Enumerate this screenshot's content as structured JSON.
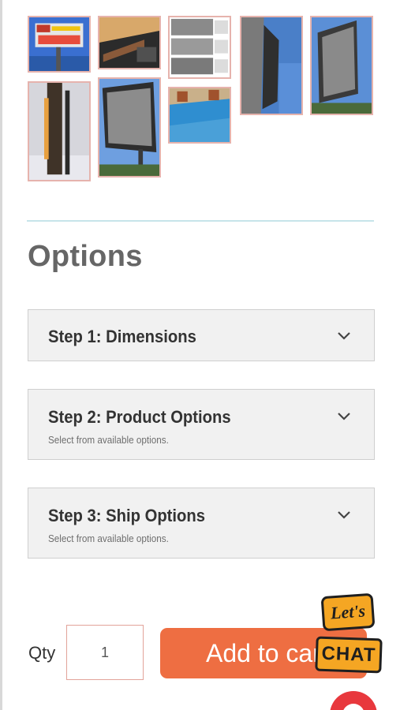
{
  "gallery": {
    "images": [
      {
        "name": "billboard-sign-photo",
        "colors": [
          "#3a6fd0",
          "#d9d9d9",
          "#c0392b"
        ]
      },
      {
        "name": "sign-underside-photo",
        "colors": [
          "#c4925a",
          "#2b2b2b",
          "#8a5a3a"
        ]
      },
      {
        "name": "sign-panels-photo",
        "colors": [
          "#cfcfcf",
          "#7a7a7a",
          "#ffffff"
        ]
      },
      {
        "name": "building-sign-photo",
        "colors": [
          "#4a7fc8",
          "#2f2f2f",
          "#7a7a7a"
        ]
      },
      {
        "name": "sign-frame-photo",
        "colors": [
          "#5b8fd6",
          "#3a3a3a",
          "#8a8a8a"
        ]
      },
      {
        "name": "pole-sign-photo",
        "colors": [
          "#d6d6dc",
          "#3f3328",
          "#e8a040"
        ]
      },
      {
        "name": "sign-panel-blue-sky-photo",
        "colors": [
          "#6e9fe0",
          "#2e2e2e",
          "#8c8c8c"
        ]
      },
      {
        "name": "blue-wall-photo",
        "colors": [
          "#2f8ed0",
          "#c9b08a",
          "#4aa0d8"
        ]
      }
    ]
  },
  "options": {
    "heading": "Options",
    "steps": [
      {
        "title": "Step 1: Dimensions",
        "subtitle": ""
      },
      {
        "title": "Step 2: Product Options",
        "subtitle": "Select from available options."
      },
      {
        "title": "Step 3: Ship Options",
        "subtitle": "Select from available options."
      }
    ]
  },
  "cart": {
    "qty_label": "Qty",
    "qty_value": "1",
    "add_button_label": "Add to cart"
  },
  "chat": {
    "top_text": "Let's",
    "bottom_text": "CHAT"
  },
  "colors": {
    "accent": "#ee6e42",
    "divider": "#c7e4ea",
    "chat": "#f5a623"
  }
}
